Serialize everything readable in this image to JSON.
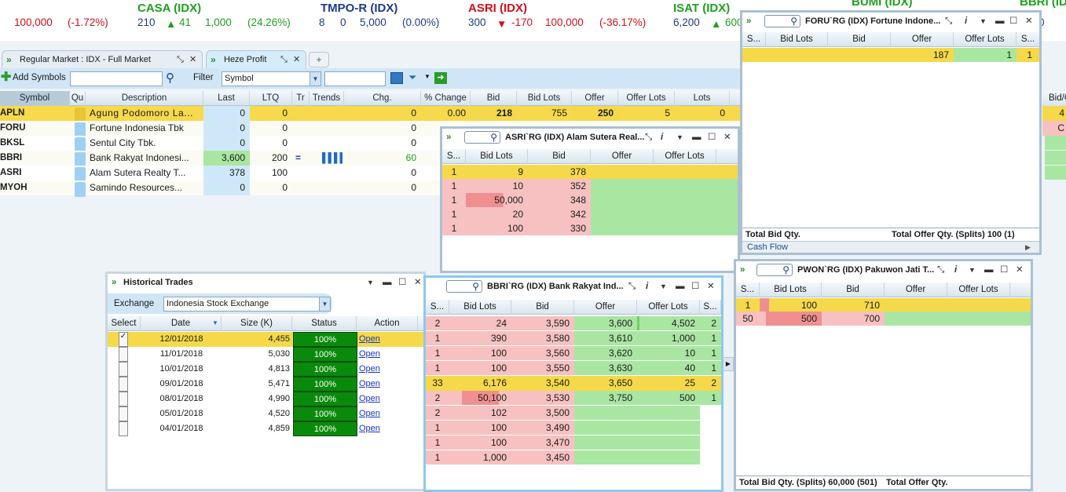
{
  "ticker": [
    {
      "name": "",
      "last": "100,000",
      "chg": "",
      "dir": "",
      "vol": "",
      "pct": "(-1.72%)",
      "color": "red"
    },
    {
      "name": "CASA (IDX)",
      "last": "210",
      "chg": "41",
      "dir": "up",
      "vol": "1,000",
      "pct": "(24.26%)",
      "color": "green"
    },
    {
      "name": "TMPO-R (IDX)",
      "last": "8",
      "chg": "0",
      "dir": "",
      "vol": "5,000",
      "pct": "(0.00%)",
      "color": "blue"
    },
    {
      "name": "ASRI (IDX)",
      "last": "300",
      "chg": "-170",
      "dir": "down",
      "vol": "100,000",
      "pct": "(-36.17%)",
      "color": "red"
    },
    {
      "name": "ISAT (IDX)",
      "last": "6,200",
      "chg": "600",
      "dir": "up",
      "vol": "",
      "pct": "",
      "color": "green"
    },
    {
      "name": "BUMI (IDX)",
      "last": "",
      "chg": "",
      "dir": "",
      "vol": "",
      "pct": "",
      "color": "green"
    },
    {
      "name": "BBRI (IDX)",
      "last": "0",
      "chg": "",
      "dir": "",
      "vol": "",
      "pct": "",
      "color": "green"
    }
  ],
  "tabs": [
    {
      "label": "Regular Market : IDX - Full Market"
    },
    {
      "label": "Heze Profit"
    }
  ],
  "toolbar": {
    "add_symbols": "Add Symbols",
    "filter": "Filter",
    "filter_value": "Symbol"
  },
  "grid": {
    "columns": [
      "Symbol",
      "Qu",
      "Description",
      "Last",
      "LTQ",
      "Tr",
      "Trends",
      "Chg.",
      "% Change",
      "Bid",
      "Bid Lots",
      "Offer",
      "Offer Lots",
      "Lots",
      "Bid/O"
    ],
    "rows": [
      {
        "symbol": "APLN",
        "desc": "Agung Podomoro La...",
        "last": "0",
        "ltq": "0",
        "tr": "",
        "chg": "0",
        "pct": "0.00",
        "bid": "218",
        "bidlots": "755",
        "offer": "250",
        "offerlots": "5",
        "lots": "0",
        "bo": "4"
      },
      {
        "symbol": "FORU",
        "desc": "Fortune Indonesia Tbk",
        "last": "0",
        "ltq": "0",
        "tr": "",
        "chg": "0",
        "pct": "",
        "bid": "",
        "bidlots": "",
        "offer": "",
        "offerlots": "",
        "lots": "",
        "bo": "C"
      },
      {
        "symbol": "BKSL",
        "desc": "Sentul City Tbk.",
        "last": "0",
        "ltq": "0",
        "tr": "",
        "chg": "0",
        "pct": "",
        "bid": "",
        "bidlots": "",
        "offer": "",
        "offerlots": "",
        "lots": "",
        "bo": ""
      },
      {
        "symbol": "BBRI",
        "desc": "Bank Rakyat Indonesi...",
        "last": "3,600",
        "ltq": "200",
        "tr": "=",
        "chg": "60",
        "pct": "",
        "bid": "",
        "bidlots": "",
        "offer": "",
        "offerlots": "",
        "lots": "",
        "bo": ""
      },
      {
        "symbol": "ASRI",
        "desc": "Alam Sutera Realty T...",
        "last": "378",
        "ltq": "100",
        "tr": "",
        "chg": "0",
        "pct": "",
        "bid": "",
        "bidlots": "",
        "offer": "",
        "offerlots": "",
        "lots": "",
        "bo": ""
      },
      {
        "symbol": "MYOH",
        "desc": "Samindo Resources...",
        "last": "0",
        "ltq": "0",
        "tr": "",
        "chg": "0",
        "pct": "",
        "bid": "",
        "bidlots": "",
        "offer": "",
        "offerlots": "",
        "lots": "",
        "bo": ""
      }
    ]
  },
  "foru": {
    "title": "FORU`RG (IDX) Fortune Indone...",
    "cols": [
      "S...",
      "Bid Lots",
      "Bid",
      "Offer",
      "Offer Lots",
      "S..."
    ],
    "rows": [
      {
        "s": "",
        "bidlots": "",
        "bid": "",
        "offer": "187",
        "offerlots": "1",
        "s2": "1"
      }
    ],
    "footer_left": "Total Bid Qty.",
    "footer_right": "Total Offer Qty. (Splits) 100 (1)",
    "cashflow": "Cash Flow"
  },
  "asri": {
    "title": "ASRI`RG (IDX) Alam Sutera Real...",
    "cols": [
      "S...",
      "Bid Lots",
      "Bid",
      "Offer",
      "Offer Lots"
    ],
    "rows": [
      {
        "s": "1",
        "bidlots": "9",
        "bid": "378"
      },
      {
        "s": "1",
        "bidlots": "10",
        "bid": "352"
      },
      {
        "s": "1",
        "bidlots": "50,000",
        "bid": "348"
      },
      {
        "s": "1",
        "bidlots": "20",
        "bid": "342"
      },
      {
        "s": "1",
        "bidlots": "100",
        "bid": "330"
      }
    ]
  },
  "bbri": {
    "title": "BBRI`RG (IDX) Bank Rakyat Ind...",
    "cols": [
      "S...",
      "Bid Lots",
      "Bid",
      "Offer",
      "Offer Lots",
      "S..."
    ],
    "rows": [
      {
        "s": "2",
        "bidlots": "24",
        "bid": "3,590",
        "offer": "3,600",
        "offerlots": "4,502",
        "s2": "2"
      },
      {
        "s": "1",
        "bidlots": "390",
        "bid": "3,580",
        "offer": "3,610",
        "offerlots": "1,000",
        "s2": "1"
      },
      {
        "s": "1",
        "bidlots": "100",
        "bid": "3,560",
        "offer": "3,620",
        "offerlots": "10",
        "s2": "1"
      },
      {
        "s": "1",
        "bidlots": "100",
        "bid": "3,550",
        "offer": "3,630",
        "offerlots": "40",
        "s2": "1"
      },
      {
        "s": "33",
        "bidlots": "6,176",
        "bid": "3,540",
        "offer": "3,650",
        "offerlots": "25",
        "s2": "2"
      },
      {
        "s": "2",
        "bidlots": "50,100",
        "bid": "3,530",
        "offer": "3,750",
        "offerlots": "500",
        "s2": "1"
      },
      {
        "s": "2",
        "bidlots": "102",
        "bid": "3,500",
        "offer": "",
        "offerlots": "",
        "s2": ""
      },
      {
        "s": "1",
        "bidlots": "100",
        "bid": "3,490",
        "offer": "",
        "offerlots": "",
        "s2": ""
      },
      {
        "s": "1",
        "bidlots": "100",
        "bid": "3,470",
        "offer": "",
        "offerlots": "",
        "s2": ""
      },
      {
        "s": "1",
        "bidlots": "1,000",
        "bid": "3,450",
        "offer": "",
        "offerlots": "",
        "s2": ""
      }
    ]
  },
  "pwon": {
    "title": "PWON`RG (IDX) Pakuwon Jati T...",
    "cols": [
      "S...",
      "Bid Lots",
      "Bid",
      "Offer",
      "Offer Lots"
    ],
    "rows": [
      {
        "s": "1",
        "bidlots": "100",
        "bid": "710"
      },
      {
        "s": "50",
        "bidlots": "500",
        "bid": "700"
      }
    ],
    "footer_left": "Total Bid Qty. (Splits) 60,000 (501)",
    "footer_right": "Total Offer Qty."
  },
  "hist": {
    "title": "Historical Trades",
    "exchange_label": "Exchange",
    "exchange_value": "Indonesia Stock Exchange",
    "cols": [
      "Select",
      "Date",
      "Size (K)",
      "Status",
      "Action"
    ],
    "rows": [
      {
        "date": "12/01/2018",
        "size": "4,455",
        "status": "100%",
        "action": "Open",
        "checked": true
      },
      {
        "date": "11/01/2018",
        "size": "5,030",
        "status": "100%",
        "action": "Open",
        "checked": false
      },
      {
        "date": "10/01/2018",
        "size": "4,813",
        "status": "100%",
        "action": "Open",
        "checked": false
      },
      {
        "date": "09/01/2018",
        "size": "5,471",
        "status": "100%",
        "action": "Open",
        "checked": false
      },
      {
        "date": "08/01/2018",
        "size": "4,990",
        "status": "100%",
        "action": "Open",
        "checked": false
      },
      {
        "date": "05/01/2018",
        "size": "4,520",
        "status": "100%",
        "action": "Open",
        "checked": false
      },
      {
        "date": "04/01/2018",
        "size": "4,859",
        "status": "100%",
        "action": "Open",
        "checked": false
      }
    ]
  }
}
